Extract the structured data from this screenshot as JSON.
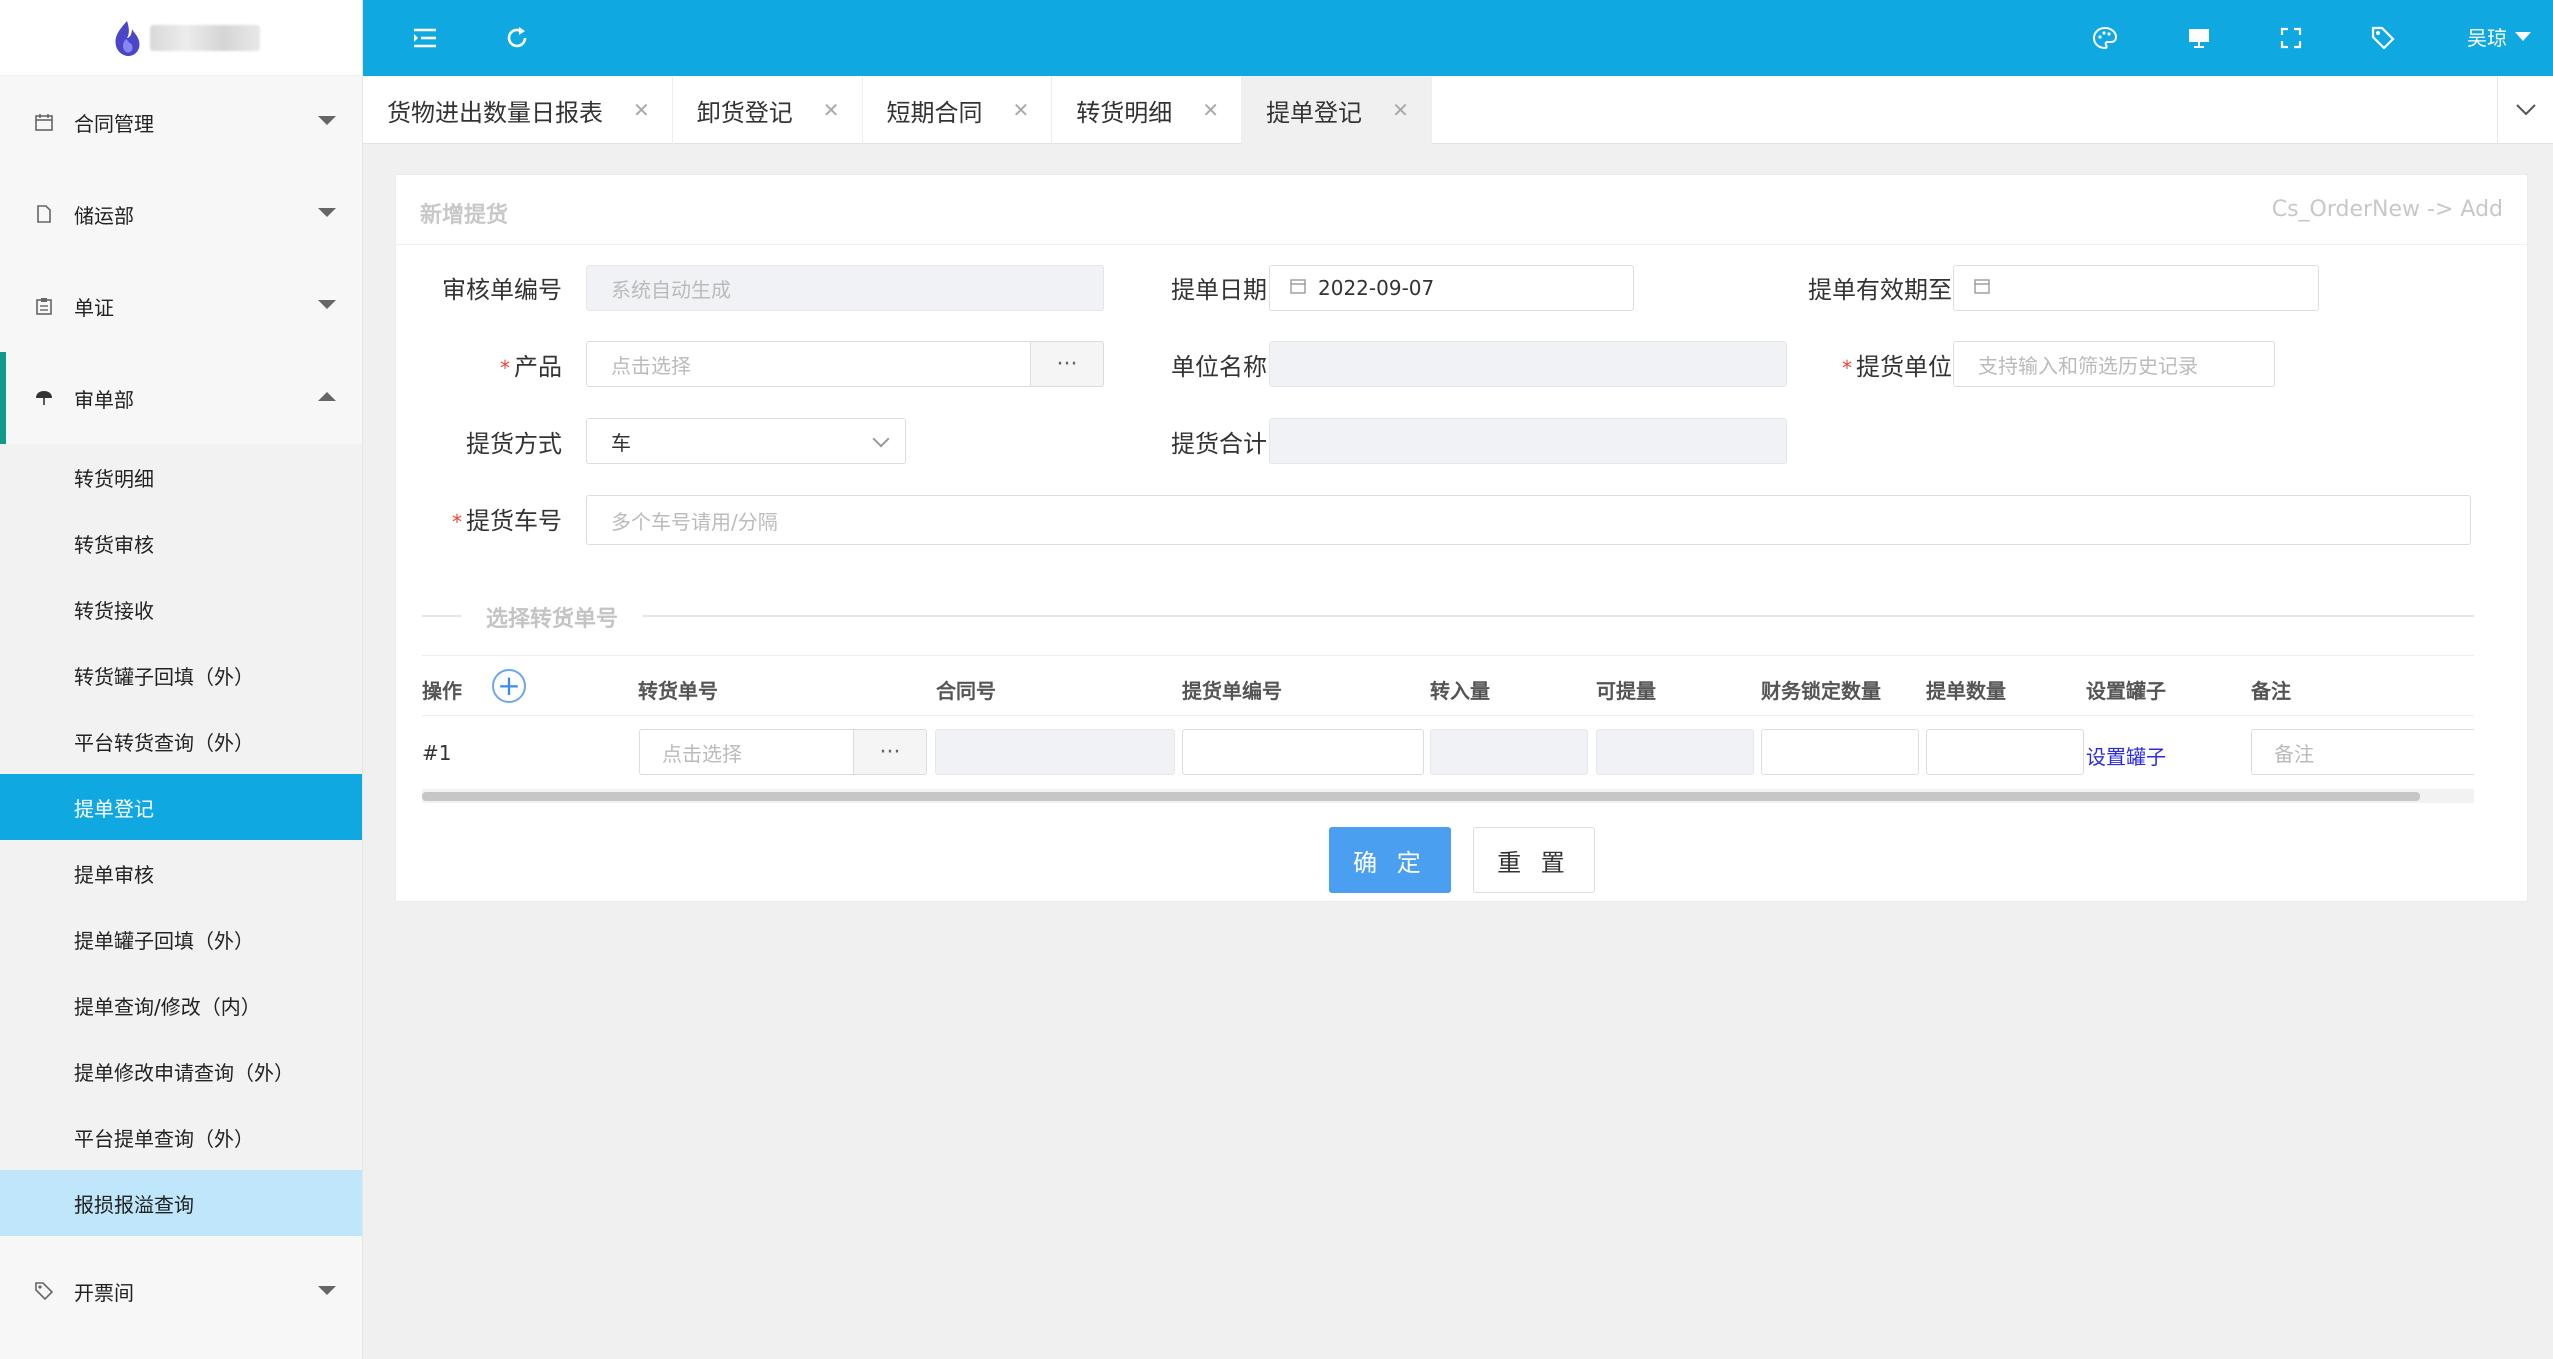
{
  "sidebar": {
    "groups": [
      {
        "label": "合同管理",
        "icon": "calendar-icon"
      },
      {
        "label": "储运部",
        "icon": "document-icon"
      },
      {
        "label": "单证",
        "icon": "clipboard-icon"
      },
      {
        "label": "审单部",
        "icon": "umbrella-icon"
      },
      {
        "label": "开票间",
        "icon": "tag-icon"
      }
    ],
    "sub_items": [
      "转货明细",
      "转货审核",
      "转货接收",
      "转货罐子回填（外）",
      "平台转货查询（外）",
      "提单登记",
      "提单审核",
      "提单罐子回填（外）",
      "提单查询/修改（内）",
      "提单修改申请查询（外）",
      "平台提单查询（外）",
      "报损报溢查询"
    ],
    "active_sub": "提单登记",
    "hover_sub": "报损报溢查询"
  },
  "topbar": {
    "user": "吴琼",
    "color": "#10a8e0"
  },
  "tabs": [
    {
      "label": "货物进出数量日报表"
    },
    {
      "label": "卸货登记"
    },
    {
      "label": "短期合同"
    },
    {
      "label": "转货明细"
    },
    {
      "label": "提单登记",
      "active": true
    }
  ],
  "form": {
    "title": "新增提货",
    "route": "Cs_OrderNew -> Add",
    "audit_no_label": "审核单编号",
    "audit_no_placeholder": "系统自动生成",
    "bill_date_label": "提单日期",
    "bill_date_value": "2022-09-07",
    "valid_until_label": "提单有效期至",
    "product_label": "产品",
    "product_placeholder": "点击选择",
    "unit_name_label": "单位名称",
    "pickup_unit_label": "提货单位",
    "pickup_unit_placeholder": "支持输入和筛选历史记录",
    "pickup_method_label": "提货方式",
    "pickup_method_value": "车",
    "pickup_total_label": "提货合计",
    "plate_label": "提货车号",
    "plate_placeholder": "多个车号请用/分隔",
    "required_mark": "*",
    "dots": "···"
  },
  "section": {
    "title": "选择转货单号"
  },
  "table": {
    "headers": [
      "操作",
      "转货单号",
      "合同号",
      "提货单编号",
      "转入量",
      "可提量",
      "财务锁定数量",
      "提单数量",
      "设置罐子",
      "备注"
    ],
    "row_index": "#1",
    "transfer_placeholder": "点击选择",
    "set_tank": "设置罐子",
    "remark_placeholder": "备注",
    "add": "+"
  },
  "buttons": {
    "confirm": "确 定",
    "reset": "重 置"
  }
}
